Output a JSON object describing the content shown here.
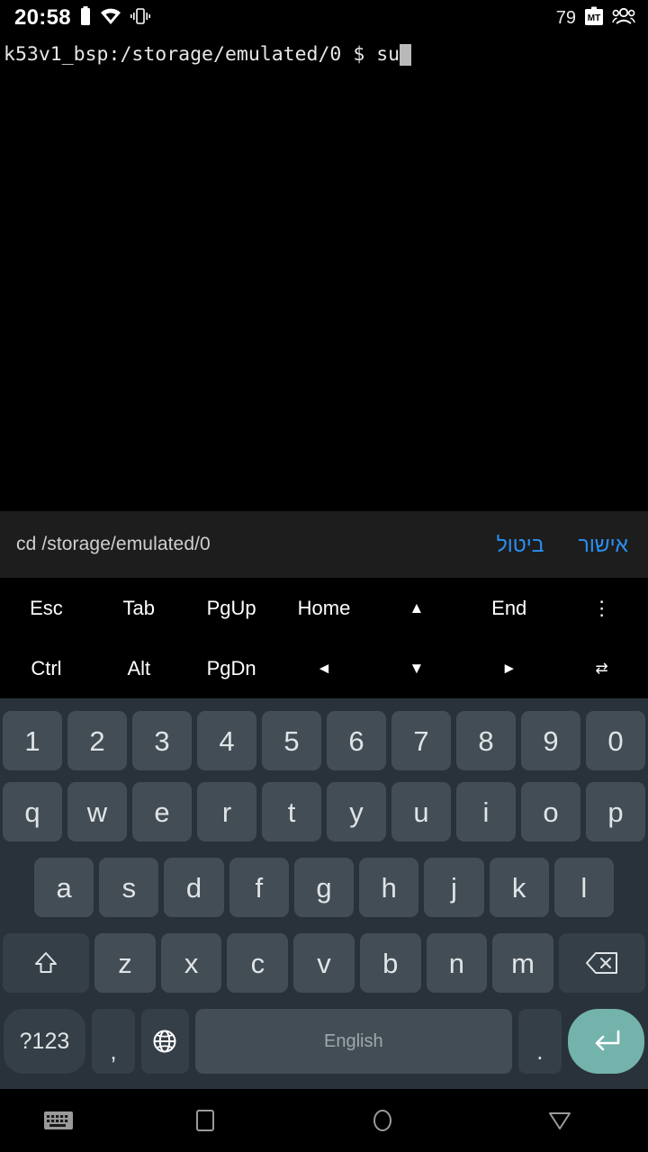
{
  "status_bar": {
    "time": "20:58",
    "battery_level": "79",
    "icons": [
      "battery-icon",
      "wifi-icon",
      "vibrate-icon",
      "mt-badge-icon",
      "people-icon"
    ]
  },
  "terminal": {
    "prompt": "k53v1_bsp:/storage/emulated/0 $ ",
    "command": "su",
    "text_color": "#e6e6e6",
    "background": "#000000"
  },
  "suggestion_bar": {
    "clip_text": "cd /storage/emulated/0",
    "cancel_label": "ביטול",
    "confirm_label": "אישור",
    "link_color": "#2a8ff0",
    "background": "#1d1d1d"
  },
  "extra_keys": {
    "row1": [
      "Esc",
      "Tab",
      "PgUp",
      "Home",
      "▲",
      "End",
      "⋮"
    ],
    "row2": [
      "Ctrl",
      "Alt",
      "PgDn",
      "◄",
      "▼",
      "►",
      "⇄"
    ]
  },
  "keyboard": {
    "background": "#29323a",
    "key_color": "#434d55",
    "key_dark_color": "#353f47",
    "enter_color": "#73b3ab",
    "number_row": [
      "1",
      "2",
      "3",
      "4",
      "5",
      "6",
      "7",
      "8",
      "9",
      "0"
    ],
    "qwerty_row": [
      "q",
      "w",
      "e",
      "r",
      "t",
      "y",
      "u",
      "i",
      "o",
      "p"
    ],
    "asdf_row": [
      "a",
      "s",
      "d",
      "f",
      "g",
      "h",
      "j",
      "k",
      "l"
    ],
    "zxcv_row": [
      "z",
      "x",
      "c",
      "v",
      "b",
      "n",
      "m"
    ],
    "shift_label": "shift-icon",
    "backspace_label": "backspace-icon",
    "symbols_label": "?123",
    "comma_label": ",",
    "globe_label": "globe-icon",
    "space_label": "English",
    "period_label": ".",
    "enter_label": "enter-icon"
  },
  "nav_bar": {
    "items": [
      "keyboard-icon",
      "recents-icon",
      "home-icon",
      "back-icon"
    ]
  }
}
